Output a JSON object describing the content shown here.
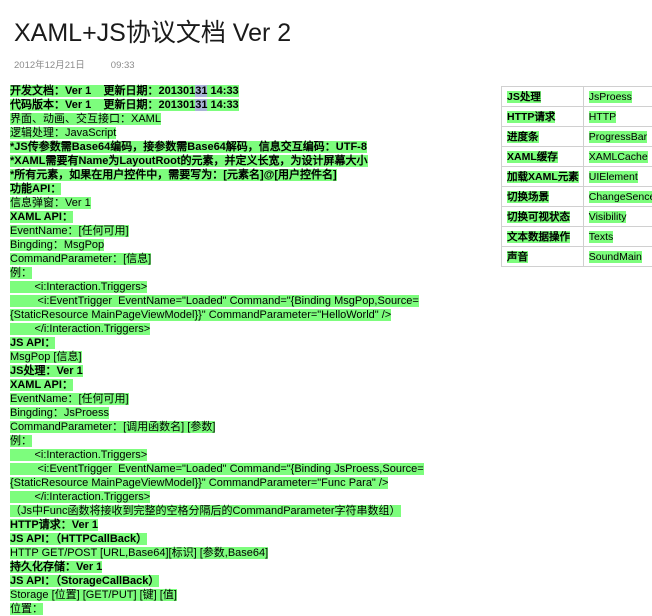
{
  "header": {
    "title": "XAML+JS协议文档 Ver 2",
    "date": "2012年12月21日",
    "time": "09:33"
  },
  "body_lines": [
    {
      "text": "开发文档：Ver 1    更新日期：20130131 14:33",
      "bold": true,
      "highlight": true,
      "selection": "31"
    },
    {
      "text": "代码版本：Ver 1    更新日期：20130131 14:33",
      "bold": true,
      "highlight": true,
      "selection": "31"
    },
    {
      "text": "界面、动画、交互接口：XAML",
      "bold": false,
      "highlight": true
    },
    {
      "text": "逻辑处理：JavaScript",
      "bold": false,
      "highlight": true
    },
    {
      "text": "*JS传参数需Base64编码，接参数需Base64解码，信息交互编码：UTF-8",
      "bold": true,
      "highlight": true
    },
    {
      "text": "*XAML需要有Name为LayoutRoot的元素，并定义长宽，为设计屏幕大小",
      "bold": true,
      "highlight": true
    },
    {
      "text": "*所有元素，如果在用户控件中，需要写为：[元素名]@[用户控件名]",
      "bold": true,
      "highlight": true
    },
    {
      "text": "功能API：",
      "bold": true,
      "highlight": true
    },
    {
      "text": "信息弹窗：Ver 1",
      "bold": false,
      "highlight": true
    },
    {
      "text": "XAML API：",
      "bold": true,
      "highlight": true
    },
    {
      "text": "EventName：[任何可用]",
      "bold": false,
      "highlight": true
    },
    {
      "text": "Bingding：MsgPop",
      "bold": false,
      "highlight": true
    },
    {
      "text": "CommandParameter：[信息]",
      "bold": false,
      "highlight": true
    },
    {
      "text": "例：",
      "bold": false,
      "highlight": true
    },
    {
      "text": "        <i:Interaction.Triggers>",
      "bold": false,
      "highlight": true
    },
    {
      "text": "         <i:EventTrigger  EventName=\"Loaded\" Command=\"{Binding MsgPop,Source={StaticResource MainPageViewModel}}\" CommandParameter=\"HelloWorld\" />",
      "bold": false,
      "highlight": true
    },
    {
      "text": "        </i:Interaction.Triggers>",
      "bold": false,
      "highlight": true
    },
    {
      "text": "JS API：",
      "bold": true,
      "highlight": true
    },
    {
      "text": "MsgPop [信息]",
      "bold": false,
      "highlight": true
    },
    {
      "text": "JS处理：Ver 1",
      "bold": true,
      "highlight": true
    },
    {
      "text": "XAML API：",
      "bold": true,
      "highlight": true
    },
    {
      "text": "EventName：[任何可用]",
      "bold": false,
      "highlight": true
    },
    {
      "text": "Bingding：JsProess",
      "bold": false,
      "highlight": true
    },
    {
      "text": "CommandParameter：[调用函数名] [参数]",
      "bold": false,
      "highlight": true
    },
    {
      "text": "例：",
      "bold": false,
      "highlight": true
    },
    {
      "text": "        <i:Interaction.Triggers>",
      "bold": false,
      "highlight": true
    },
    {
      "text": "         <i:EventTrigger  EventName=\"Loaded\" Command=\"{Binding JsProess,Source={StaticResource MainPageViewModel}}\" CommandParameter=\"Func Para\" />",
      "bold": false,
      "highlight": true
    },
    {
      "text": "        </i:Interaction.Triggers>",
      "bold": false,
      "highlight": true
    },
    {
      "text": "（Js中Func函数将接收到完整的空格分隔后的CommandParameter字符串数组）",
      "bold": false,
      "highlight": true
    },
    {
      "text": "HTTP请求：Ver 1",
      "bold": true,
      "highlight": true
    },
    {
      "text": "JS API：（HTTPCallBack）",
      "bold": true,
      "highlight": true
    },
    {
      "text": "HTTP GET/POST [URL,Base64][标识] [参数,Base64]",
      "bold": false,
      "highlight": true
    },
    {
      "text": "持久化存储：Ver 1",
      "bold": true,
      "highlight": true
    },
    {
      "text": "JS API：（StorageCallBack）",
      "bold": true,
      "highlight": true
    },
    {
      "text": "Storage [位置] [GET/PUT] [键] [值]",
      "bold": false,
      "highlight": true
    },
    {
      "text": "位置：",
      "bold": false,
      "highlight": true
    }
  ],
  "api_table": {
    "rows": [
      {
        "name": "JS处理",
        "api": "JsProess"
      },
      {
        "name": "HTTP请求",
        "api": "HTTP"
      },
      {
        "name": "进度条",
        "api": "ProgressBar"
      },
      {
        "name": "XAML缓存",
        "api": "XAMLCache"
      },
      {
        "name": "加载XAML元素",
        "api": "UIElement"
      },
      {
        "name": "切换场景",
        "api": "ChangeSence"
      },
      {
        "name": "切换可视状态",
        "api": "Visibility"
      },
      {
        "name": "文本数据操作",
        "api": "Texts"
      },
      {
        "name": "声音",
        "api": "SoundMain"
      }
    ]
  },
  "colors": {
    "highlight_green": "#7dfd7d",
    "selection_blue": "#a8b4d6",
    "title": "#1a1a1a",
    "meta": "#8c8c8c",
    "table_border": "#d0d0d0"
  }
}
